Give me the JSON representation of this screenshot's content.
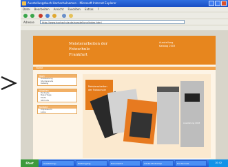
{
  "window": {
    "title": "Ausstellungsbuch Hochschulnamen – Microsoft Internet Explorer",
    "menu": [
      "Datei",
      "Bearbeiten",
      "Ansicht",
      "Favoriten",
      "Extras",
      "?"
    ]
  },
  "addressbar": {
    "label": "Adresse",
    "url": "http://www.hochschule.de/ausstellung/index.html"
  },
  "page": {
    "title_lines": [
      "Meisterarbeiten der",
      "Fotoschule",
      "Frankfurt"
    ],
    "header_right": [
      "Ausstellung",
      "Katalog 2003"
    ],
    "nav_label": "Home",
    "sidebar": [
      {
        "heading": "Start",
        "items": [
          "Ausstellung",
          "Studierende",
          "Katalog"
        ]
      },
      {
        "heading": "Arbeiten",
        "items": [
          "Portraits",
          "Reportage",
          "Mode",
          "Still Life"
        ]
      },
      {
        "heading": "Kontakt",
        "items": [
          "Impressum",
          "Links"
        ]
      }
    ],
    "feature_text": [
      "Meisterarbeiten",
      "der Fotoschule"
    ],
    "preview_text": "Ausstellung 2003"
  },
  "taskbar": {
    "start_label": "Start",
    "tasks": [
      "Ausstellung...",
      "Posteingang",
      "Dokument1",
      "Adobe Photoshop",
      "Hochschule"
    ],
    "clock": "10:42"
  },
  "colors": {
    "header_orange": "#e7861e",
    "nav_orange": "#f2a34a",
    "page_bg": "#fdf4e6",
    "titlebar_blue": "#1a4fc4"
  }
}
